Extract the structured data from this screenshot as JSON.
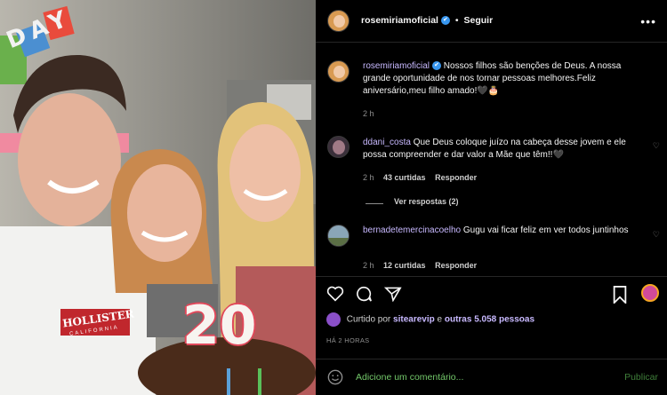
{
  "post": {
    "username": "rosemiriamoficial",
    "follow_label": "Seguir",
    "separator": "•",
    "more_icon": "more-dots-icon",
    "verified_glyph": "✔"
  },
  "photo": {
    "banner_letters": "DAY",
    "shirt_text": "HOLLISTER",
    "shirt_subtext": "CALIFORNIA",
    "cake_number": "20"
  },
  "caption": {
    "username": "rosemiriamoficial",
    "text": "Nossos filhos são benções de Deus. A nossa grande oportunidade de nos tornar pessoas melhores.Feliz aniversário,meu filho amado!🖤🎂",
    "time": "2 h"
  },
  "comments": [
    {
      "username": "ddani_costa",
      "text": "Que Deus coloque juízo na cabeça desse jovem e ele possa compreender e dar valor a Mãe que têm!!🖤",
      "time": "2 h",
      "likes": "43 curtidas",
      "reply": "Responder",
      "view_replies": "Ver respostas (2)"
    },
    {
      "username": "bernadetemercinacoelho",
      "text": "Gugu vai ficar feliz em ver todos juntinhos",
      "time": "2 h",
      "likes": "12 curtidas",
      "reply": "Responder"
    }
  ],
  "likes_summary": {
    "prefix": "Curtido por",
    "user": "sitearevip",
    "conj": "e",
    "others": "outras 5.058 pessoas"
  },
  "posted_ago": "HÁ 2 HORAS",
  "add_comment": {
    "placeholder": "Adicione um comentário...",
    "post_label": "Publicar"
  },
  "colors": {
    "background": "#000000",
    "link": "#c8b9ff",
    "comment_input": "#73c86a",
    "verified": "#3897f0"
  }
}
